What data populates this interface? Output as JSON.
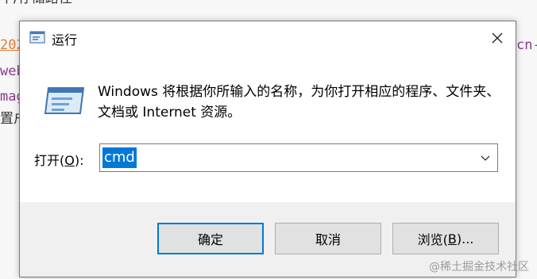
{
  "background": {
    "top_text": "中/存储路径",
    "line1": "202",
    "line2": "webi",
    "line3": "mag",
    "line4": "置户",
    "right_text": "cn-"
  },
  "dialog": {
    "title": "运行",
    "description": "Windows 将根据你所输入的名称，为你打开相应的程序、文件夹、文档或 Internet 资源。",
    "open_label_prefix": "打开(",
    "open_label_key": "O",
    "open_label_suffix": "):",
    "input_value": "cmd",
    "buttons": {
      "ok": "确定",
      "cancel": "取消",
      "browse_prefix": "浏览(",
      "browse_key": "B",
      "browse_suffix": ")..."
    }
  },
  "watermark": "@稀土掘金技术社区",
  "colors": {
    "accent": "#0078d7",
    "footer": "#f0f0f0"
  }
}
